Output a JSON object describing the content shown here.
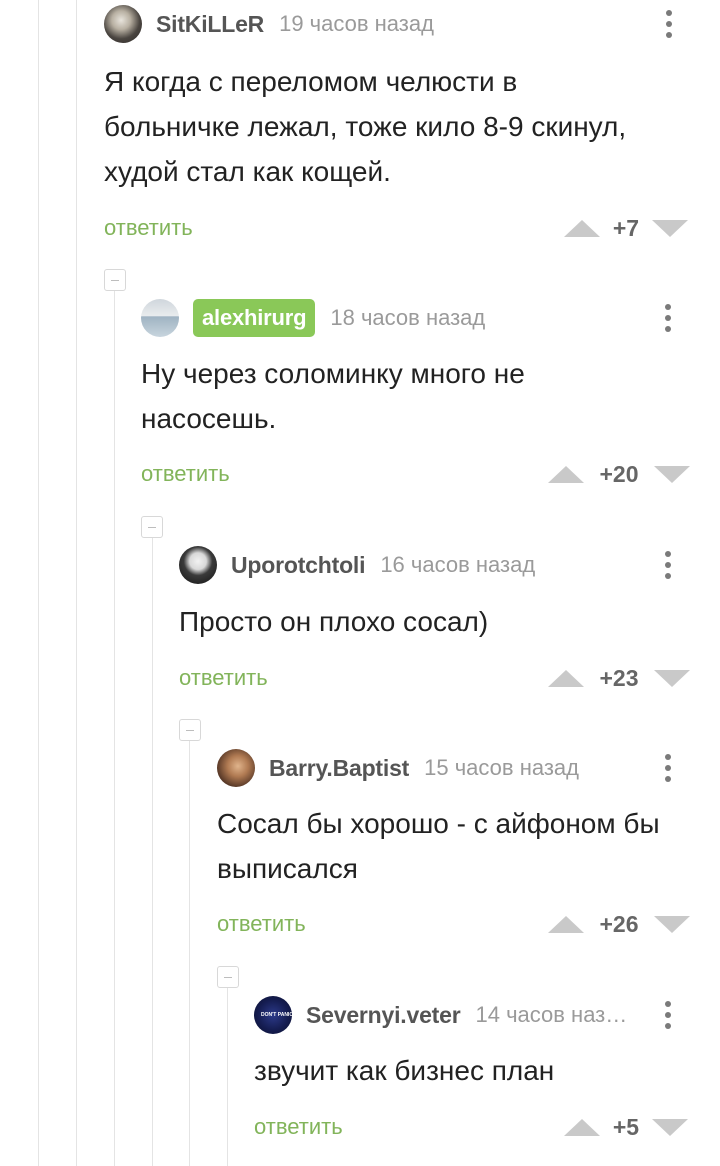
{
  "comments": [
    {
      "username": "SitKiLLeR",
      "time": "19 часов назад",
      "text": [
        "Я когда с переломом челюсти в",
        "больничке лежал, тоже кило 8-9 скинул,",
        "худой стал как кощей."
      ],
      "reply_label": "ответить",
      "rating": "+7",
      "avatar_icon": "wolf-avatar"
    },
    {
      "username": "alexhirurg",
      "is_author": true,
      "time": "18 часов назад",
      "text": [
        "Ну через соломинку много не",
        "насосешь."
      ],
      "reply_label": "ответить",
      "rating": "+20",
      "avatar_icon": "surgeon-avatar"
    },
    {
      "username": "Uporotchtoli",
      "time": "16 часов назад",
      "text": [
        "Просто он плохо сосал)"
      ],
      "reply_label": "ответить",
      "rating": "+23",
      "avatar_icon": "face-avatar"
    },
    {
      "username": "Barry.Baptist",
      "time": "15 часов назад",
      "text": [
        "Сосал бы хорошо - с айфоном бы",
        "выписался"
      ],
      "reply_label": "ответить",
      "rating": "+26",
      "avatar_icon": "man-avatar"
    },
    {
      "username": "Severnyi.veter",
      "time": "14 часов наз…",
      "text": [
        "звучит как бизнес план"
      ],
      "reply_label": "ответить",
      "rating": "+5",
      "avatar_icon": "dont-panic-avatar",
      "avatar_text": "DON'T PANIC"
    }
  ],
  "colors": {
    "reply_link": "#82b45a",
    "author_badge": "#8ac858",
    "thread_line": "#e4e4e4"
  }
}
